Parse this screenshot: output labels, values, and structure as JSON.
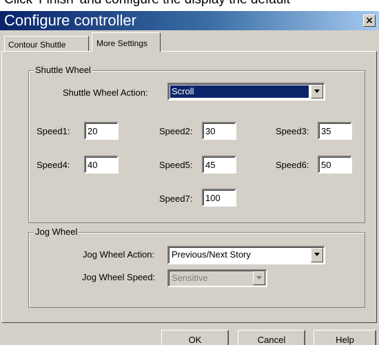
{
  "above_window_text": "Click 'Finish' and configure the display the default",
  "window": {
    "title": "Configure controller",
    "close_glyph": "×"
  },
  "tabs": [
    {
      "label": "Contour Shuttle",
      "selected": false
    },
    {
      "label": "More Settings",
      "selected": true
    }
  ],
  "shuttle_wheel": {
    "group_label": "Shuttle Wheel",
    "action_label": "Shuttle Wheel  Action:",
    "action_value": "Scroll",
    "speeds": [
      {
        "label": "Speed1:",
        "value": "20"
      },
      {
        "label": "Speed2:",
        "value": "30"
      },
      {
        "label": "Speed3:",
        "value": "35"
      },
      {
        "label": "Speed4:",
        "value": "40"
      },
      {
        "label": "Speed5:",
        "value": "45"
      },
      {
        "label": "Speed6:",
        "value": "50"
      },
      {
        "label": "Speed7:",
        "value": "100"
      }
    ]
  },
  "jog_wheel": {
    "group_label": "Jog Wheel",
    "action_label": "Jog Wheel Action:",
    "action_value": "Previous/Next Story",
    "speed_label": "Jog Wheel Speed:",
    "speed_value": "Sensitive",
    "speed_enabled": false
  },
  "buttons": {
    "ok": "OK",
    "cancel": "Cancel",
    "help": "Help"
  },
  "colors": {
    "title_bar_start": "#0a246a",
    "title_bar_end": "#a6caf0",
    "dialog_face": "#d4d0c8",
    "selection": "#0a246a"
  }
}
